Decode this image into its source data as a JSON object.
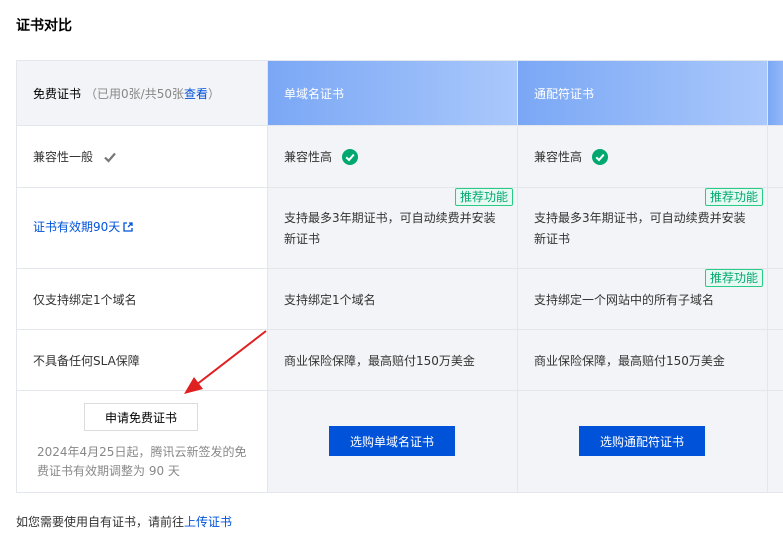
{
  "page": {
    "title": "证书对比"
  },
  "header": {
    "free_title": "免费证书",
    "free_usage": "（已用0张/共50张",
    "free_view_link": "查看",
    "free_close_paren": "）",
    "single_title": "单域名证书",
    "wildcard_title": "通配符证书"
  },
  "rows": {
    "compat": {
      "free": "兼容性一般",
      "single": "兼容性高",
      "wildcard": "兼容性高"
    },
    "validity": {
      "free_link": "证书有效期90天",
      "single": "支持最多3年期证书，可自动续费并安装新证书",
      "wildcard": "支持最多3年期证书，可自动续费并安装新证书",
      "badge": "推荐功能"
    },
    "domain": {
      "free": "仅支持绑定1个域名",
      "single": "支持绑定1个域名",
      "wildcard": "支持绑定一个网站中的所有子域名",
      "badge": "推荐功能"
    },
    "sla": {
      "free": "不具备任何SLA保障",
      "single": "商业保险保障，最高赔付150万美金",
      "wildcard": "商业保险保障，最高赔付150万美金"
    }
  },
  "actions": {
    "free_button": "申请免费证书",
    "free_note": "2024年4月25日起，腾讯云新签发的免费证书有效期调整为 90 天",
    "single_button": "选购单域名证书",
    "wildcard_button": "选购通配符证书"
  },
  "footer": {
    "text": "如您需要使用自有证书，请前往",
    "link": "上传证书"
  },
  "colors": {
    "primary": "#0052d9",
    "success": "#00a870",
    "arrow": "#e02020"
  },
  "icons": {
    "check_gray": "check-icon",
    "check_green": "check-circle-icon",
    "external": "external-link-icon"
  }
}
